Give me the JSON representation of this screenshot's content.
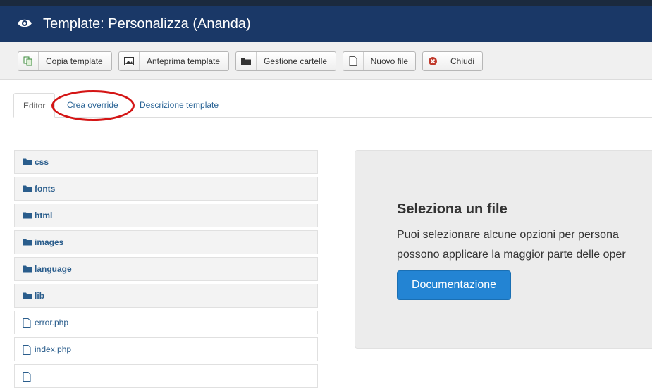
{
  "header": {
    "title": "Template: Personalizza (Ananda)",
    "icon": "eye-icon"
  },
  "toolbar": {
    "buttons": [
      {
        "label": "Copia template",
        "icon": "copy-icon"
      },
      {
        "label": "Anteprima template",
        "icon": "image-icon"
      },
      {
        "label": "Gestione cartelle",
        "icon": "folder-icon"
      },
      {
        "label": "Nuovo file",
        "icon": "file-icon"
      },
      {
        "label": "Chiudi",
        "icon": "close-circle-icon"
      }
    ]
  },
  "tabs": [
    {
      "label": "Editor",
      "active": true
    },
    {
      "label": "Crea override",
      "active": false
    },
    {
      "label": "Descrizione template",
      "active": false
    }
  ],
  "tree": {
    "folders": [
      "css",
      "fonts",
      "html",
      "images",
      "language",
      "lib"
    ],
    "files": [
      "error.php",
      "index.php"
    ]
  },
  "panel": {
    "heading": "Seleziona un file",
    "text_line1": "Puoi selezionare alcune opzioni per persona",
    "text_line2": "possono applicare la maggior parte delle oper",
    "button": "Documentazione"
  },
  "colors": {
    "header_bg": "#1a3867",
    "accent_blue": "#2384d3",
    "annotation_red": "#d41515"
  }
}
